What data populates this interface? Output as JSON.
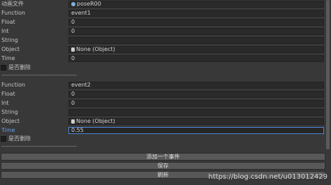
{
  "anim": {
    "label": "动画文件",
    "value": "poseR00"
  },
  "events": [
    {
      "function_label": "Function",
      "function_value": "event1",
      "float_label": "Float",
      "float_value": "0",
      "int_label": "Int",
      "int_value": "0",
      "string_label": "String",
      "string_value": "",
      "object_label": "Object",
      "object_value": "None (Object)",
      "time_label": "Time",
      "time_value": "0",
      "delete_label": "是否删除"
    },
    {
      "function_label": "Function",
      "function_value": "event2",
      "float_label": "Float",
      "float_value": "0",
      "int_label": "Int",
      "int_value": "0",
      "string_label": "String",
      "string_value": "",
      "object_label": "Object",
      "object_value": "None (Object)",
      "time_label": "Time",
      "time_value": "0.55",
      "delete_label": "是否删除"
    }
  ],
  "divider": "-----------------------------------------------------",
  "buttons": {
    "add": "添加一个事件",
    "save": "保存",
    "refresh": "刷新"
  },
  "watermark": "https://blog.csdn.net/u013012429",
  "colors": {
    "active_label": "#6a9fe8",
    "active_border": "#4a86d8"
  }
}
